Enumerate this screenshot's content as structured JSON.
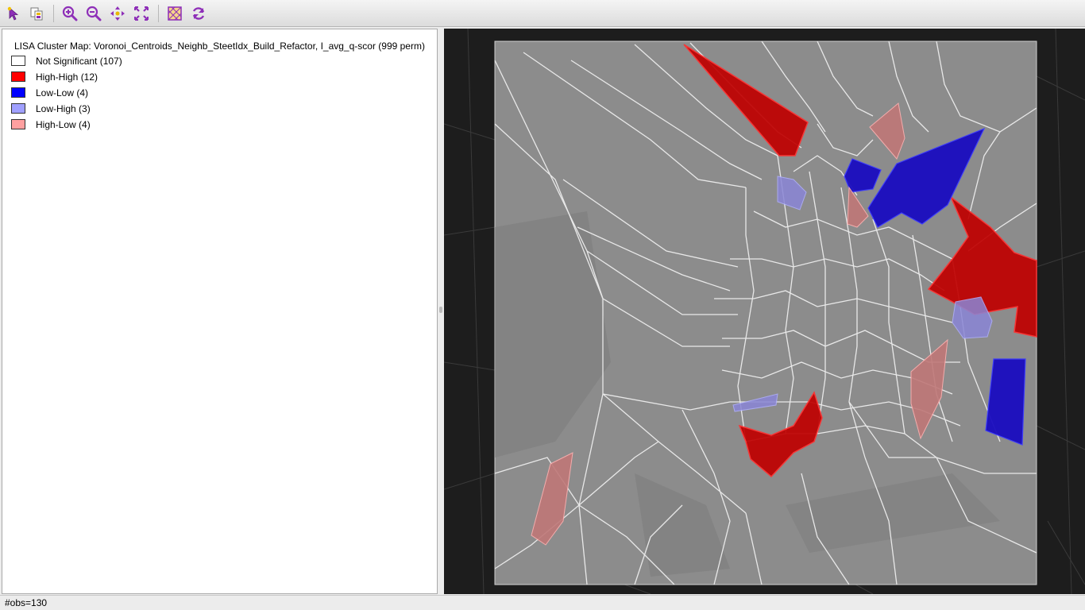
{
  "toolbar": {
    "buttons": [
      {
        "name": "select-icon"
      },
      {
        "name": "copy-map-icon"
      },
      {
        "name": "zoom-in-icon"
      },
      {
        "name": "zoom-out-icon"
      },
      {
        "name": "pan-icon"
      },
      {
        "name": "fit-extent-icon"
      },
      {
        "name": "basemap-icon"
      },
      {
        "name": "refresh-icon"
      }
    ],
    "icon_color": "#8e2fb8"
  },
  "legend": {
    "title": "LISA Cluster Map: Voronoi_Centroids_Neighb_SteetIdx_Build_Refactor, I_avg_q-scor (999 perm)",
    "items": [
      {
        "label": "Not Significant (107)",
        "color": "#ffffff"
      },
      {
        "label": "High-High (12)",
        "color": "#ff0000"
      },
      {
        "label": "Low-Low (4)",
        "color": "#0000ff"
      },
      {
        "label": "Low-High (3)",
        "color": "#a0a0ff"
      },
      {
        "label": "High-Low (4)",
        "color": "#ffa0a0"
      }
    ]
  },
  "status": {
    "obs": "#obs=130"
  },
  "colors": {
    "high_high": "#ff0000",
    "low_low": "#0000ff",
    "low_high": "#a0a0ff",
    "high_low": "#ffa0a0",
    "not_significant": "#ffffff",
    "basemap": "#1d1d1d"
  }
}
